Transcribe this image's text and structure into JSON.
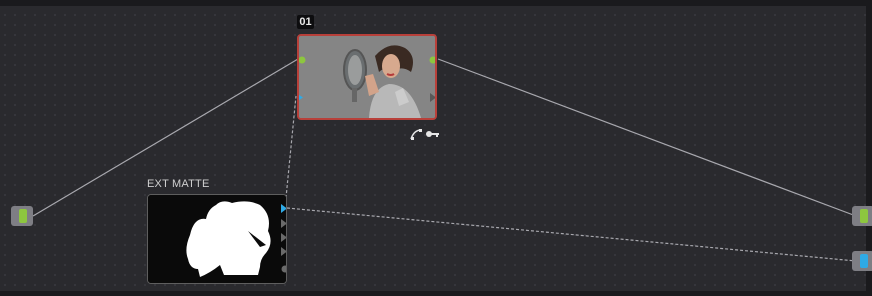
{
  "node_editor": {
    "serial_node": {
      "number": "01",
      "thumbnail": "woman-with-hand-mirror"
    },
    "external_matte": {
      "title": "EXT MATTE",
      "thumbnail": "white-silhouette-matte"
    }
  },
  "icons": [
    "curves-icon",
    "key-icon"
  ],
  "colors": {
    "background": "#2a2a2e",
    "rgb_link": "#8dc63f",
    "alpha_link": "#2eaae6",
    "selected_node_border": "#b8403a",
    "wire": "#a8a8ae"
  }
}
